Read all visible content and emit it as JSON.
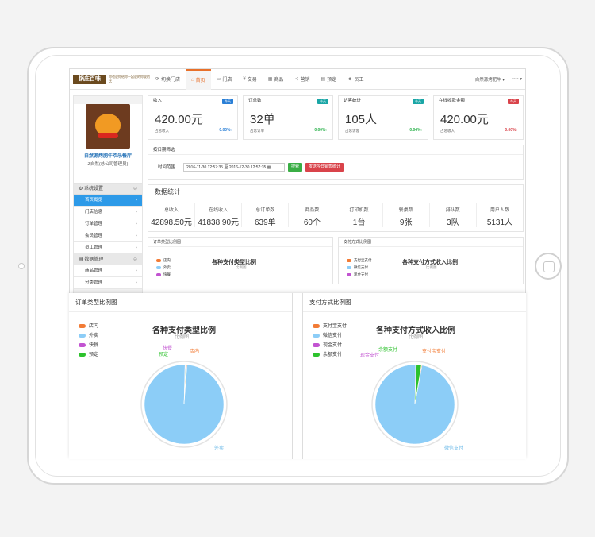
{
  "topbar": {
    "logo_text": "锅庄百味",
    "tagline": "你也说你给你一起说的你说的话",
    "nav": [
      {
        "label": "切换门店",
        "icon": "refresh-icon",
        "active": false
      },
      {
        "label": "首页",
        "icon": "home-icon",
        "active": true
      },
      {
        "label": "门店",
        "icon": "monitor-icon",
        "active": false
      },
      {
        "label": "交易",
        "icon": "yen-icon",
        "active": false
      },
      {
        "label": "商品",
        "icon": "grid-icon",
        "active": false
      },
      {
        "label": "营销",
        "icon": "share-icon",
        "active": false
      },
      {
        "label": "预定",
        "icon": "book-icon",
        "active": false
      },
      {
        "label": "员工",
        "icon": "user-icon",
        "active": false
      }
    ],
    "store_selector": "自然源烤肥牛 ▾",
    "user_menu": "•••• ▾"
  },
  "sidebar": {
    "store_name": "自然源烤肥牛欢乐餐厅",
    "store_sub": "Z自然(总公司管理员)",
    "groups": [
      {
        "label": "系统设置",
        "items": [
          {
            "label": "首页概览",
            "active": true
          },
          {
            "label": "门店信息",
            "active": false
          },
          {
            "label": "订单管理",
            "active": false
          },
          {
            "label": "会员管理",
            "active": false
          },
          {
            "label": "员工管理",
            "active": false
          }
        ]
      },
      {
        "label": "数据管理",
        "items": [
          {
            "label": "商品管理",
            "active": false
          },
          {
            "label": "分类管理",
            "active": false
          }
        ]
      }
    ]
  },
  "cards": [
    {
      "title": "收入",
      "badge": "今天",
      "badge_color": "#2a7fd6",
      "value": "420.00元",
      "sub": "占总收入",
      "pct": "0.00%↑",
      "pct_color": "#2a7fd6"
    },
    {
      "title": "订单数",
      "badge": "今天",
      "badge_color": "#1aa6a6",
      "value": "32单",
      "sub": "占总订单",
      "pct": "0.00%↑",
      "pct_color": "#2bb24c"
    },
    {
      "title": "访客统计",
      "badge": "今天",
      "badge_color": "#1aa6a6",
      "value": "105人",
      "sub": "占总访客",
      "pct": "0.04%↑",
      "pct_color": "#2bb24c"
    },
    {
      "title": "在线收款金额",
      "badge": "今天",
      "badge_color": "#d9434a",
      "value": "420.00元",
      "sub": "占总收入",
      "pct": "0.00%↑",
      "pct_color": "#d9434a"
    }
  ],
  "filter": {
    "title": "按日期筛选",
    "range_label": "时间范围",
    "date_value": "2016-11-30 12:57:35 至 2016-12-30 12:57:35",
    "search_label": "搜索",
    "today_label": "发送今日销售统计"
  },
  "stats": {
    "title": "数据统计",
    "items": [
      {
        "label": "总收入",
        "value": "42898.50元"
      },
      {
        "label": "在线收入",
        "value": "41838.90元"
      },
      {
        "label": "总订单数",
        "value": "639单"
      },
      {
        "label": "商品数",
        "value": "60个"
      },
      {
        "label": "打印机数",
        "value": "1台"
      },
      {
        "label": "餐桌数",
        "value": "9张"
      },
      {
        "label": "排队数",
        "value": "3队"
      },
      {
        "label": "用户人数",
        "value": "5131人"
      }
    ]
  },
  "mini_panels": [
    {
      "head": "订单类型比例图",
      "title": "各种支付类型比例",
      "sub": "比例图",
      "legend": [
        "店内",
        "外卖",
        "快餐"
      ]
    },
    {
      "head": "支付方式比例图",
      "title": "各种支付方式收入比例",
      "sub": "比例图",
      "legend": [
        "支付宝支付",
        "微信支付",
        "现金支付"
      ]
    }
  ],
  "colors": {
    "accent": "#e8702a",
    "sidebar_active": "#2d9ae8",
    "pie_main": "#8ccdf7",
    "orange": "#f27b35",
    "blue": "#8ccdf7",
    "purple": "#c253d1",
    "green": "#2dc22d"
  },
  "chart_data": [
    {
      "type": "pie",
      "panel_title": "订单类型比例图",
      "title": "各种支付类型比例",
      "subtitle": "比例图",
      "legend": [
        "店内",
        "外卖",
        "快餐",
        "预定"
      ],
      "series": [
        {
          "values": [
            0.4,
            99.2,
            0.2,
            0.2
          ]
        }
      ],
      "categories": [
        "店内",
        "外卖",
        "快餐",
        "预定"
      ],
      "slice_labels": [
        "店内",
        "外卖",
        "快餐",
        "预定"
      ],
      "slice_colors": [
        "#f27b35",
        "#8ccdf7",
        "#c253d1",
        "#2dc22d"
      ]
    },
    {
      "type": "pie",
      "panel_title": "支付方式比例图",
      "title": "各种支付方式收入比例",
      "subtitle": "比例图",
      "legend": [
        "支付宝支付",
        "微信支付",
        "现金支付",
        "余额支付"
      ],
      "categories": [
        "支付宝支付",
        "微信支付",
        "现金支付",
        "余额支付"
      ],
      "series": [
        {
          "values": [
            0.3,
            97.4,
            0.3,
            2.0
          ]
        }
      ],
      "slice_labels": [
        "支付宝支付",
        "微信支付",
        "现金支付",
        "余额支付"
      ],
      "slice_colors": [
        "#f27b35",
        "#8ccdf7",
        "#c253d1",
        "#2dc22d"
      ]
    }
  ]
}
